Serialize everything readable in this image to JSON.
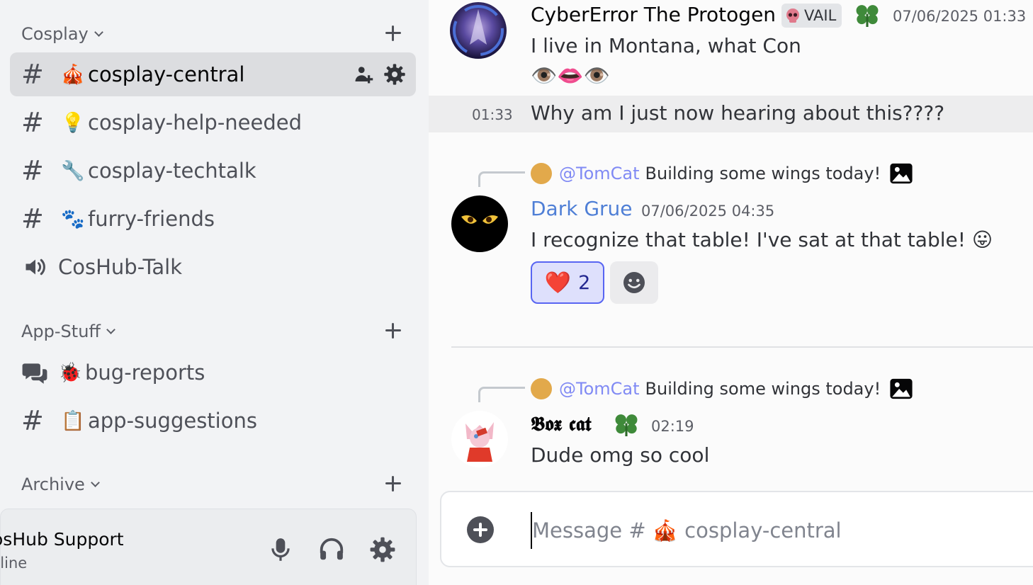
{
  "sidebar": {
    "categories": [
      {
        "label": "Cosplay"
      },
      {
        "label": "App-Stuff"
      },
      {
        "label": "Archive"
      }
    ],
    "channels": [
      {
        "icon": "hash-icon",
        "emoji": "🎪",
        "label": "cosplay-central"
      },
      {
        "icon": "hash-icon",
        "emoji": "💡",
        "label": "cosplay-help-needed"
      },
      {
        "icon": "hash-icon",
        "emoji": "🔧",
        "label": "cosplay-techtalk"
      },
      {
        "icon": "hash-icon",
        "emoji": "🐾",
        "label": "furry-friends"
      },
      {
        "icon": "speaker-icon",
        "emoji": "",
        "label": "CosHub-Talk"
      },
      {
        "icon": "forum-icon",
        "emoji": "🐞",
        "label": "bug-reports"
      },
      {
        "icon": "hash-icon",
        "emoji": "📋",
        "label": "app-suggestions"
      }
    ],
    "hash_glyph": "#",
    "user": {
      "name": "osHub Support",
      "status": "nline"
    }
  },
  "chat": {
    "messages": [
      {
        "author": "CyberError The Protogen",
        "tag": "VAIL",
        "timestamp": "07/06/2025 01:33",
        "text": "I live in Montana, what Con",
        "emoji_line": "👁️👄👁️"
      },
      {
        "timestamp": "01:33",
        "text": "Why am I just now hearing about this????"
      },
      {
        "reply_mention": "@TomCat",
        "reply_text": "Building some wings today!",
        "author": "Dark Grue",
        "timestamp": "07/06/2025 04:35",
        "text": "I recognize that table! I've sat at that table! 😛",
        "reaction_emoji": "❤️",
        "reaction_count": "2"
      },
      {
        "reply_mention": "@TomCat",
        "reply_text": "Building some wings today!",
        "author": "𝕭𝖔𝖝 𝖈𝖆𝖙",
        "timestamp": "02:19",
        "text": "Dude omg so cool"
      }
    ],
    "composer": {
      "placeholder": "Message # 🎪 cosplay-central"
    }
  },
  "colors": {
    "accent": "#5865f2",
    "mention": "#8b93ef",
    "dark_grue": "#4f7fd6",
    "clover": "#3f8a3a"
  }
}
